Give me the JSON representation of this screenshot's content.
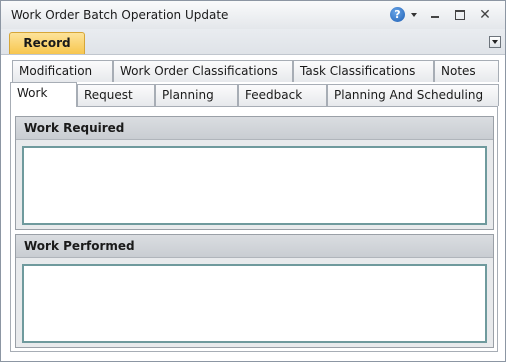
{
  "window": {
    "title": "Work Order Batch Operation Update",
    "help_glyph": "?",
    "close_glyph": "✕"
  },
  "ribbon": {
    "active_tab": "Record"
  },
  "tabs": {
    "row1": [
      "Modification",
      "Work Order Classifications",
      "Task Classifications",
      "Notes"
    ],
    "row2": [
      "Work",
      "Request",
      "Planning",
      "Feedback",
      "Planning And Scheduling"
    ],
    "selected": "Work"
  },
  "sections": {
    "work_required": {
      "title": "Work Required",
      "value": ""
    },
    "work_performed": {
      "title": "Work Performed",
      "value": ""
    }
  },
  "colors": {
    "active_ribbon_tab": "#f7c64e",
    "field_border": "#6f9a9d",
    "help_icon": "#1e5fb4"
  }
}
